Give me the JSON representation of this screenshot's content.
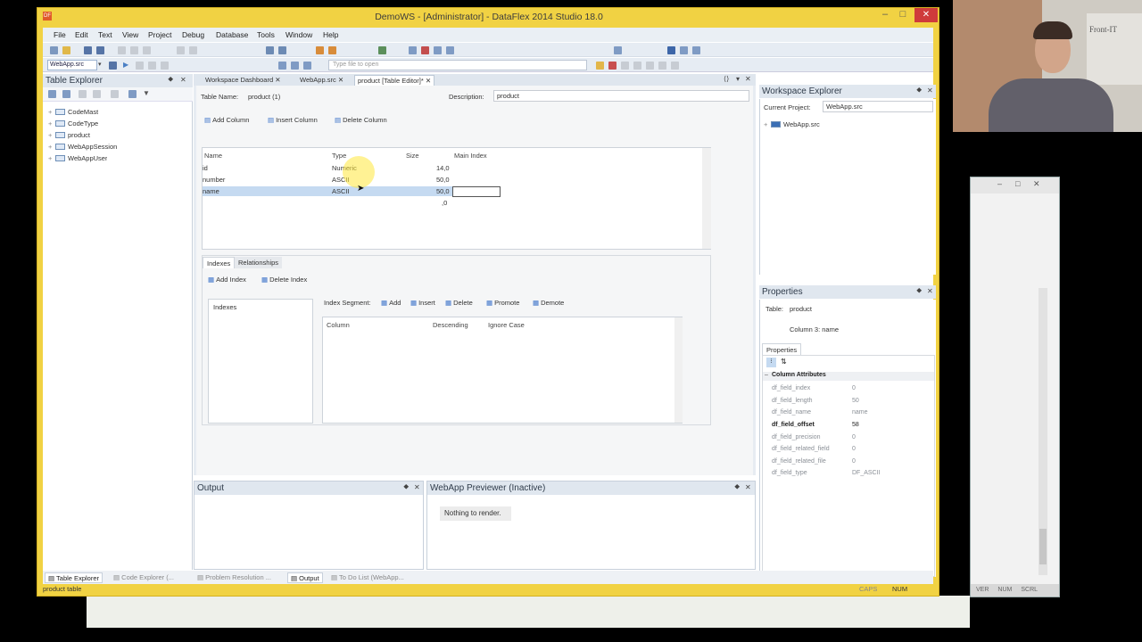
{
  "window": {
    "title": "DemoWS - [Administrator] - DataFlex 2014 Studio 18.0",
    "app_icon": "DF",
    "min": "–",
    "max": "□",
    "close": "✕"
  },
  "menu": [
    "File",
    "Edit",
    "Text",
    "View",
    "Project",
    "Debug",
    "Database",
    "Tools",
    "Window",
    "Help"
  ],
  "toolbar": {
    "project_select": "WebApp.src",
    "type_file_placeholder": "Type file to open"
  },
  "table_explorer": {
    "title": "Table Explorer",
    "items": [
      "CodeMast",
      "CodeType",
      "product",
      "WebAppSession",
      "WebAppUser"
    ]
  },
  "tabs": [
    {
      "label": "Workspace Dashboard"
    },
    {
      "label": "WebApp.src"
    },
    {
      "label": "product [Table Editor]*"
    }
  ],
  "editor": {
    "table_name_label": "Table Name:",
    "table_name_value": "product (1)",
    "description_label": "Description:",
    "description_value": "product",
    "add_column": "Add Column",
    "insert_column": "Insert Column",
    "delete_column": "Delete Column",
    "headers": [
      "Name",
      "Type",
      "Size",
      "Main Index"
    ],
    "rows": [
      {
        "name": "id",
        "type": "Numeric",
        "size": "14,0"
      },
      {
        "name": "number",
        "type": "ASCII",
        "size": "50,0"
      },
      {
        "name": "name",
        "type": "ASCII",
        "size": "50,0"
      },
      {
        "name": "",
        "type": "",
        "size": ",0"
      }
    ],
    "tab_indexes": "Indexes",
    "tab_relationships": "Relationships",
    "add_index": "Add Index",
    "delete_index": "Delete Index",
    "indexes_header": "Indexes",
    "index_segment": "Index Segment:",
    "seg_add": "Add",
    "seg_insert": "Insert",
    "seg_delete": "Delete",
    "seg_promote": "Promote",
    "seg_demote": "Demote",
    "seg_headers": [
      "Column",
      "Descending",
      "Ignore Case"
    ]
  },
  "workspace": {
    "title": "Workspace Explorer",
    "current_project_label": "Current Project:",
    "current_project": "WebApp.src",
    "tree_item": "WebApp.src"
  },
  "properties": {
    "title": "Properties",
    "table_label": "Table:",
    "table_value": "product",
    "column_label": "Column 3: name",
    "tab": "Properties",
    "section": "Column Attributes",
    "rows": [
      {
        "name": "df_field_index",
        "value": "0"
      },
      {
        "name": "df_field_length",
        "value": "50"
      },
      {
        "name": "df_field_name",
        "value": "name"
      },
      {
        "name": "df_field_offset",
        "value": "58"
      },
      {
        "name": "df_field_precision",
        "value": "0"
      },
      {
        "name": "df_field_related_field",
        "value": "0"
      },
      {
        "name": "df_field_related_file",
        "value": "0"
      },
      {
        "name": "df_field_type",
        "value": "DF_ASCII"
      }
    ]
  },
  "output": {
    "title": "Output"
  },
  "previewer": {
    "title": "WebApp Previewer (Inactive)",
    "message": "Nothing to render."
  },
  "bottom_tabs": [
    "Table Explorer",
    "Code Explorer (...",
    "Problem Resolution ...",
    "Output",
    "To Do List (WebApp..."
  ],
  "status": {
    "left": "product table",
    "caps": "CAPS",
    "num": "NUM"
  },
  "background_window": {
    "status": [
      "VER",
      "NUM",
      "SCRL"
    ]
  },
  "webcam": {
    "poster_text": "Front-IT"
  }
}
